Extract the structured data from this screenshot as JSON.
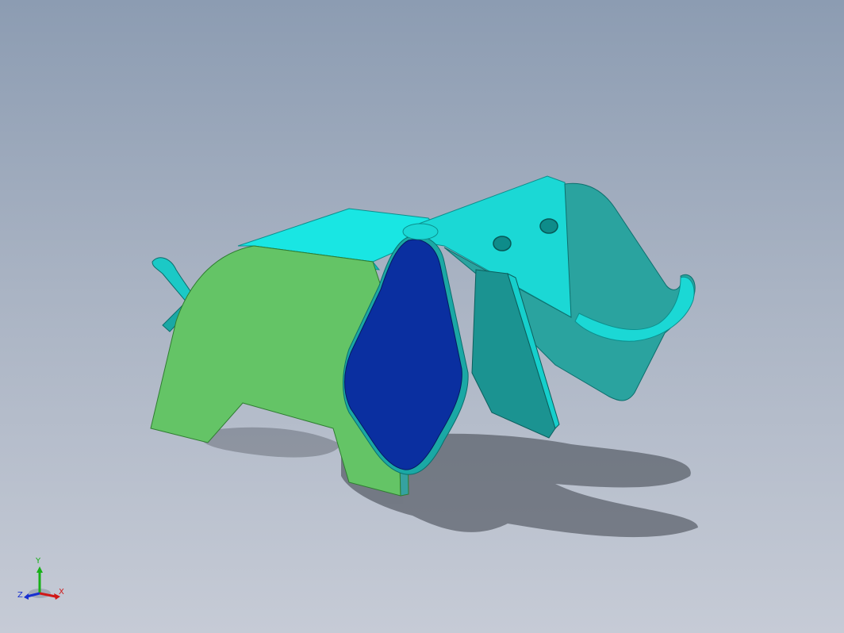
{
  "viewport": {
    "background_top": "#8c9cb2",
    "background_bottom": "#c6cbd6"
  },
  "model": {
    "body_color": "#64c466",
    "ear_color": "#0a2fa0",
    "head_color": "#2aa39f",
    "top_color": "#19e6e3"
  },
  "triad": {
    "x_label": "X",
    "y_label": "Y",
    "z_label": "Z",
    "x_color": "#d01818",
    "y_color": "#18b018",
    "z_color": "#1830d0"
  }
}
